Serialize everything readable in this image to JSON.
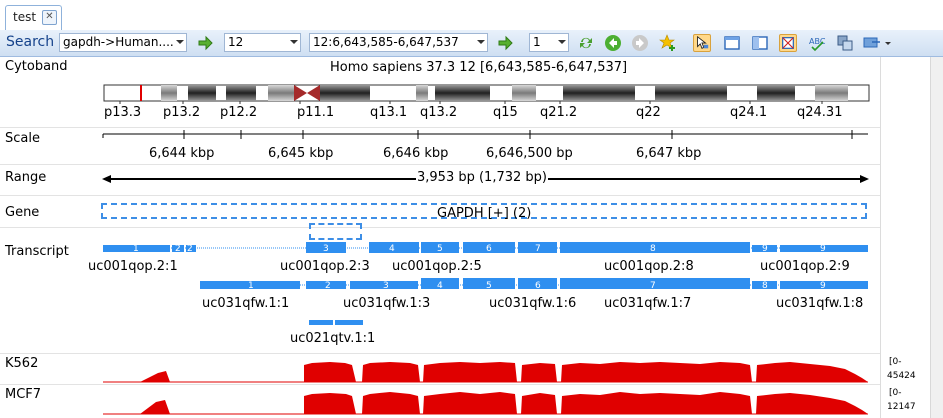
{
  "tab": {
    "label": "test",
    "close": "✕"
  },
  "toolbar": {
    "search_label": "Search",
    "dataset_value": "gapdh->Human....",
    "chromosome_value": "12",
    "location_value": "12:6,643,585-6,647,537",
    "page_value": "1",
    "icons": [
      "go-arrow-icon",
      "go-arrow-icon",
      "refresh-icon",
      "back-icon",
      "forward-icon",
      "add-bookmark-icon",
      "select-tool-icon",
      "single-view-icon",
      "split-view-icon",
      "fit-icon",
      "spell-icon",
      "layout-icon",
      "export-dropdown-icon"
    ]
  },
  "tracks": {
    "cytoband": {
      "label": "Cytoband",
      "title": "Homo sapiens 37.3 12 [6,643,585-6,647,537]",
      "bands": [
        "p13.3",
        "p13.2",
        "p12.2",
        "p11.1",
        "q13.1",
        "q13.2",
        "q15",
        "q21.2",
        "q22",
        "q24.1",
        "q24.31"
      ]
    },
    "scale": {
      "label": "Scale",
      "ticks": [
        "6,644 kbp",
        "6,645 kbp",
        "6,646 kbp",
        "6,646,500 bp",
        "6,647 kbp"
      ]
    },
    "range": {
      "label": "Range",
      "text": "3,953 bp (1,732 bp)"
    },
    "gene": {
      "label": "Gene",
      "text": "GAPDH [+] (2)"
    },
    "transcript": {
      "label": "Transcript",
      "names": [
        "uc001qop.2:1",
        "uc001qop.2:3",
        "uc001qop.2:5",
        "uc001qop.2:8",
        "uc001qop.2:9",
        "uc031qfw.1:1",
        "uc031qfw.1:3",
        "uc031qfw.1:6",
        "uc031qfw.1:7",
        "uc031qfw.1:8",
        "uc021qtv.1:1"
      ],
      "exon_numbers_1": [
        "1",
        "2",
        "2",
        "3",
        "4",
        "5",
        "6",
        "7",
        "8",
        "9",
        "9"
      ],
      "exon_numbers_2": [
        "1",
        "2",
        "3",
        "4",
        "5",
        "6",
        "7",
        "8",
        "9"
      ]
    },
    "k562": {
      "label": "K562",
      "range_top": "[0-",
      "range_bottom": "45424"
    },
    "mcf7": {
      "label": "MCF7",
      "range_top": "[0-",
      "range_bottom": "12147"
    }
  },
  "colors": {
    "exon": "#2f8ff0",
    "coverage": "#e00000",
    "centromere": "#a52a2a",
    "accent": "#3d8ee6"
  }
}
